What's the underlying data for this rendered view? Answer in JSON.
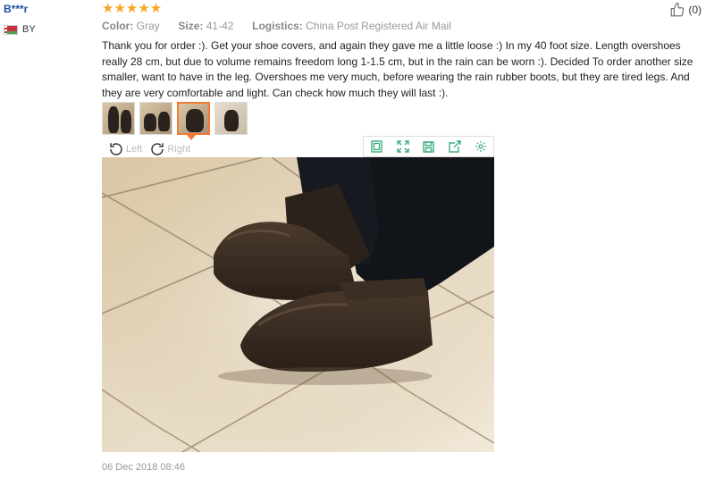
{
  "reviewer": {
    "name": "B***r",
    "country": "BY"
  },
  "rating": {
    "stars": 5,
    "stars_text": "★★★★★"
  },
  "helpful": {
    "count": "(0)"
  },
  "attributes": [
    {
      "label": "Color:",
      "value": "Gray"
    },
    {
      "label": "Size:",
      "value": "41-42"
    },
    {
      "label": "Logistics:",
      "value": "China Post Registered Air Mail"
    }
  ],
  "review_text": "Thank you for order :). Get your shoe covers, and again they gave me a little loose :) In my 40 foot size. Length overshoes really 28 cm, but due to volume remains freedom long 1-1.5 cm, but in the rain can be worn :). Decided To order another size smaller, want to have in the leg. Overshoes me very much, before wearing the rain rubber boots, but they are tired legs. And they are very comfortable and light. Can check how much they will last :).",
  "thumbnails": {
    "count": 4,
    "active_index": 2
  },
  "viewer": {
    "rotate_left": "Left",
    "rotate_right": "Right",
    "tools": [
      "fit-icon",
      "fullscreen-icon",
      "save-icon",
      "share-icon",
      "settings-icon"
    ]
  },
  "colors": {
    "accent": "#f27a31",
    "star": "#f8a623",
    "tool_icon": "#3aaf7d",
    "name": "#1e4fa1"
  },
  "date": "06 Dec 2018 08:46"
}
